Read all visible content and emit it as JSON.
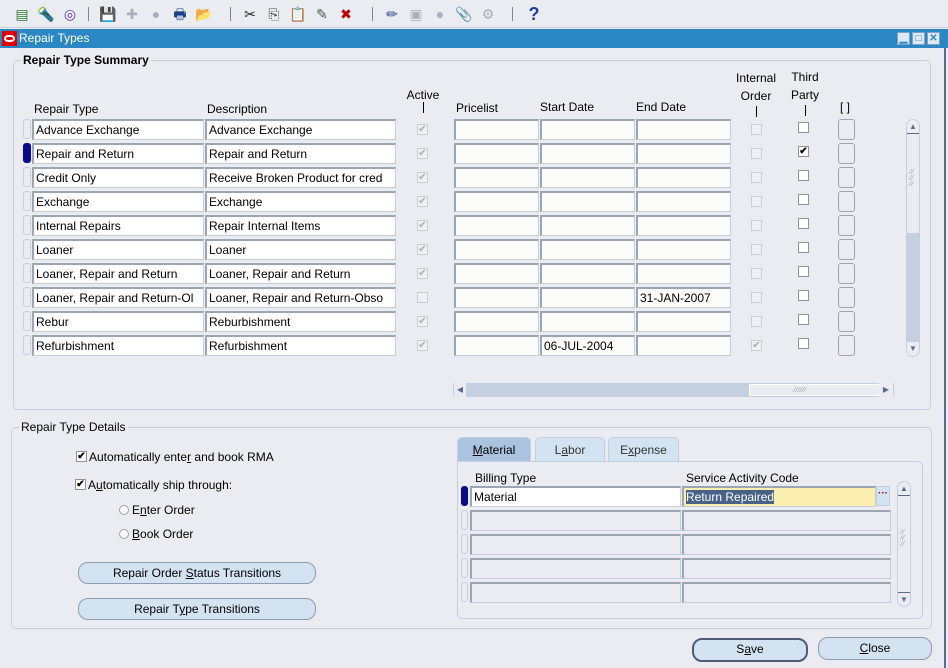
{
  "toolbar": {
    "icons": [
      {
        "name": "new-record-icon",
        "glyph": "▤"
      },
      {
        "name": "find-icon",
        "glyph": "🔦"
      },
      {
        "name": "navigator-icon",
        "glyph": "◎"
      },
      {
        "name": "save-icon",
        "glyph": "💾"
      },
      {
        "name": "next-step-icon",
        "glyph": "✚"
      },
      {
        "name": "switch-responsibility-icon",
        "glyph": "●"
      },
      {
        "name": "print-icon",
        "glyph": "🖶"
      },
      {
        "name": "close-form-icon",
        "glyph": "📂"
      },
      {
        "name": "cut-icon",
        "glyph": "✂"
      },
      {
        "name": "copy-icon",
        "glyph": "⎘"
      },
      {
        "name": "paste-icon",
        "glyph": "📋"
      },
      {
        "name": "clear-record-icon",
        "glyph": "✎"
      },
      {
        "name": "delete-record-icon",
        "glyph": "✖"
      },
      {
        "name": "edit-field-icon",
        "glyph": "✏"
      },
      {
        "name": "zoom-icon",
        "glyph": "▣"
      },
      {
        "name": "translations-icon",
        "glyph": "●"
      },
      {
        "name": "attachments-icon",
        "glyph": "📎"
      },
      {
        "name": "folder-tools-icon",
        "glyph": "⚙"
      },
      {
        "name": "help-icon",
        "glyph": "?"
      }
    ]
  },
  "window": {
    "title": "Repair Types",
    "controls": {
      "minimize": "▁",
      "maximize": "□",
      "close": "✕"
    }
  },
  "summary": {
    "title": "Repair Type Summary",
    "columns": {
      "repair_type": "Repair Type",
      "description": "Description",
      "active": "Active",
      "pricelist": "Pricelist",
      "start_date": "Start Date",
      "end_date": "End Date",
      "internal_order_1": "Internal",
      "internal_order_2": "Order",
      "third_party_1": "Third",
      "third_party_2": "Party",
      "folder": "[ ]"
    },
    "rows": [
      {
        "repair_type": "Advance Exchange",
        "description": "Advance Exchange",
        "active": true,
        "pricelist": "",
        "start_date": "",
        "end_date": "",
        "internal_order": false,
        "third_party": false,
        "current": false
      },
      {
        "repair_type": "Repair and Return",
        "description": "Repair and Return",
        "active": true,
        "pricelist": "",
        "start_date": "",
        "end_date": "",
        "internal_order": false,
        "third_party": true,
        "current": true
      },
      {
        "repair_type": "Credit Only",
        "description": "Receive Broken Product for cred",
        "active": true,
        "pricelist": "",
        "start_date": "",
        "end_date": "",
        "internal_order": false,
        "third_party": false,
        "current": false
      },
      {
        "repair_type": "Exchange",
        "description": "Exchange",
        "active": true,
        "pricelist": "",
        "start_date": "",
        "end_date": "",
        "internal_order": false,
        "third_party": false,
        "current": false
      },
      {
        "repair_type": "Internal Repairs",
        "description": "Repair Internal Items",
        "active": true,
        "pricelist": "",
        "start_date": "",
        "end_date": "",
        "internal_order": false,
        "third_party": false,
        "current": false
      },
      {
        "repair_type": "Loaner",
        "description": "Loaner",
        "active": true,
        "pricelist": "",
        "start_date": "",
        "end_date": "",
        "internal_order": false,
        "third_party": false,
        "current": false
      },
      {
        "repair_type": "Loaner, Repair and Return",
        "description": "Loaner, Repair and Return",
        "active": true,
        "pricelist": "",
        "start_date": "",
        "end_date": "",
        "internal_order": false,
        "third_party": false,
        "current": false
      },
      {
        "repair_type": "Loaner, Repair and Return-Ol",
        "description": "Loaner, Repair and Return-Obso",
        "active": false,
        "pricelist": "",
        "start_date": "",
        "end_date": "31-JAN-2007",
        "internal_order": false,
        "third_party": false,
        "current": false
      },
      {
        "repair_type": "Rebur",
        "description": "Reburbishment",
        "active": true,
        "pricelist": "",
        "start_date": "",
        "end_date": "",
        "internal_order": false,
        "third_party": false,
        "current": false
      },
      {
        "repair_type": "Refurbishment",
        "description": "Refurbishment",
        "active": true,
        "pricelist": "",
        "start_date": "06-JUL-2004",
        "end_date": "",
        "internal_order": true,
        "third_party": false,
        "current": false
      }
    ]
  },
  "details": {
    "title": "Repair Type Details",
    "auto_enter_book_rma": {
      "label_pre": "Automatically ente",
      "label_u": "r",
      "label_post": " and book RMA",
      "checked": true
    },
    "auto_ship": {
      "label_pre": "A",
      "label_u": "u",
      "label_post": "tomatically ship through:",
      "checked": true
    },
    "radio_enter_order": {
      "label_pre": "E",
      "label_u": "n",
      "label_post": "ter Order",
      "selected": false
    },
    "radio_book_order": {
      "label_pre": "",
      "label_u": "B",
      "label_post": "ook Order",
      "selected": false
    },
    "btn_status_transitions": {
      "label_pre": "Repair Order ",
      "label_u": "S",
      "label_post": "tatus Transitions"
    },
    "btn_type_transitions": {
      "label_pre": "Repair T",
      "label_u": "y",
      "label_post": "pe Transitions"
    },
    "tabs": [
      {
        "label_pre": "",
        "label_u": "M",
        "label_post": "aterial",
        "active": true
      },
      {
        "label_pre": "L",
        "label_u": "a",
        "label_post": "bor",
        "active": false
      },
      {
        "label_pre": "E",
        "label_u": "x",
        "label_post": "pense",
        "active": false
      }
    ],
    "billing": {
      "col_billing_type": "Billing Type",
      "col_service_activity": "Service Activity Code",
      "rows": [
        {
          "billing_type": "Material",
          "service_activity": "Return Repaired"
        },
        {
          "billing_type": "",
          "service_activity": ""
        },
        {
          "billing_type": "",
          "service_activity": ""
        },
        {
          "billing_type": "",
          "service_activity": ""
        },
        {
          "billing_type": "",
          "service_activity": ""
        }
      ],
      "lov_glyph": "···"
    }
  },
  "footer": {
    "save": {
      "label_pre": "S",
      "label_u": "a",
      "label_post": "ve"
    },
    "close": {
      "label_pre": "",
      "label_u": "C",
      "label_post": "lose"
    }
  },
  "colors": {
    "titlebar": "#2b86c4",
    "current_record": "#0a0a8c",
    "selection_bg": "#4a6187",
    "lov_field": "#fbeeb1"
  }
}
